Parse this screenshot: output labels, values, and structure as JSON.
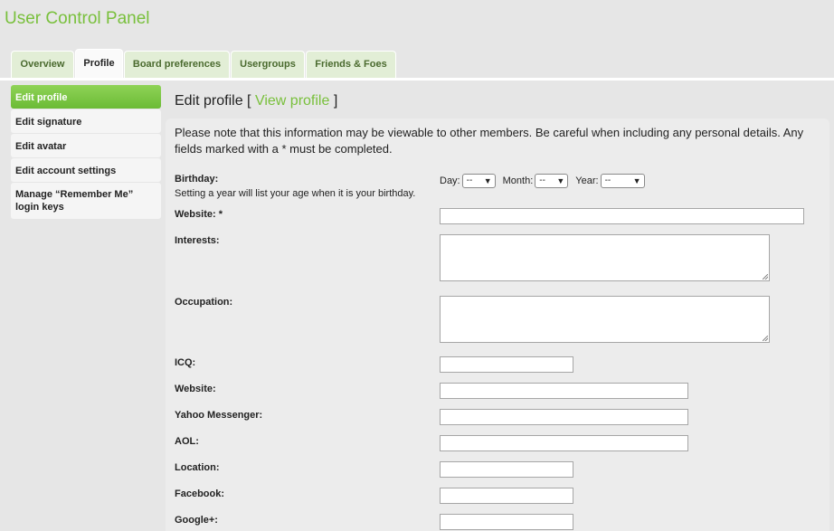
{
  "panel": {
    "title": "User Control Panel"
  },
  "tabs": [
    {
      "label": "Overview"
    },
    {
      "label": "Profile"
    },
    {
      "label": "Board preferences"
    },
    {
      "label": "Usergroups"
    },
    {
      "label": "Friends & Foes"
    }
  ],
  "sidebar": {
    "items": [
      {
        "label": "Edit profile"
      },
      {
        "label": "Edit signature"
      },
      {
        "label": "Edit avatar"
      },
      {
        "label": "Edit account settings"
      },
      {
        "label": "Manage “Remember Me” login keys"
      }
    ]
  },
  "heading": {
    "title": "Edit profile",
    "open_bracket": "[",
    "link": "View profile",
    "close_bracket": "]"
  },
  "notice": "Please note that this information may be viewable to other members. Be careful when including any personal details. Any fields marked with a * must be completed.",
  "birthday": {
    "label": "Birthday:",
    "explain": "Setting a year will list your age when it is your birthday.",
    "day_label": "Day:",
    "day_value": "--",
    "month_label": "Month:",
    "month_value": "--",
    "year_label": "Year:",
    "year_value": "--"
  },
  "fields": {
    "website_required": "Website: *",
    "interests": "Interests:",
    "occupation": "Occupation:",
    "icq": "ICQ:",
    "website": "Website:",
    "yahoo": "Yahoo Messenger:",
    "aol": "AOL:",
    "location": "Location:",
    "facebook": "Facebook:",
    "googleplus": "Google+:"
  },
  "colors": {
    "accent": "#79c03c",
    "active_menu": "#6bbb35",
    "background": "#e6e6e6"
  }
}
